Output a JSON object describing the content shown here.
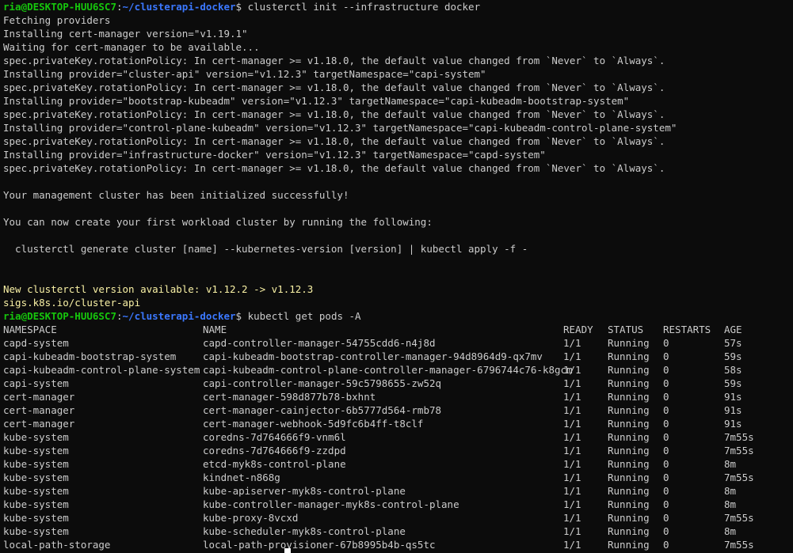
{
  "prompt": {
    "user_host": "ria@DESKTOP-HUU6SC7",
    "separator": ":",
    "path": "~/clusterapi-docker",
    "symbol": "$"
  },
  "commands": {
    "init": "clusterctl init --infrastructure docker",
    "get_pods": "kubectl get pods -A"
  },
  "init_output": [
    "Fetching providers",
    "Installing cert-manager version=\"v1.19.1\"",
    "Waiting for cert-manager to be available...",
    "spec.privateKey.rotationPolicy: In cert-manager >= v1.18.0, the default value changed from `Never` to `Always`.",
    "Installing provider=\"cluster-api\" version=\"v1.12.3\" targetNamespace=\"capi-system\"",
    "spec.privateKey.rotationPolicy: In cert-manager >= v1.18.0, the default value changed from `Never` to `Always`.",
    "Installing provider=\"bootstrap-kubeadm\" version=\"v1.12.3\" targetNamespace=\"capi-kubeadm-bootstrap-system\"",
    "spec.privateKey.rotationPolicy: In cert-manager >= v1.18.0, the default value changed from `Never` to `Always`.",
    "Installing provider=\"control-plane-kubeadm\" version=\"v1.12.3\" targetNamespace=\"capi-kubeadm-control-plane-system\"",
    "spec.privateKey.rotationPolicy: In cert-manager >= v1.18.0, the default value changed from `Never` to `Always`.",
    "Installing provider=\"infrastructure-docker\" version=\"v1.12.3\" targetNamespace=\"capd-system\"",
    "spec.privateKey.rotationPolicy: In cert-manager >= v1.18.0, the default value changed from `Never` to `Always`."
  ],
  "success_message": "Your management cluster has been initialized successfully!",
  "next_steps_message": "You can now create your first workload cluster by running the following:",
  "generate_command": "  clusterctl generate cluster [name] --kubernetes-version [version] | kubectl apply -f -",
  "update_notice": {
    "line1": "New clusterctl version available: v1.12.2 -> v1.12.3",
    "line2": "sigs.k8s.io/cluster-api"
  },
  "pods_table": {
    "headers": [
      "NAMESPACE",
      "NAME",
      "READY",
      "STATUS",
      "RESTARTS",
      "AGE"
    ],
    "rows": [
      [
        "capd-system",
        "capd-controller-manager-54755cdd6-n4j8d",
        "1/1",
        "Running",
        "0",
        "57s"
      ],
      [
        "capi-kubeadm-bootstrap-system",
        "capi-kubeadm-bootstrap-controller-manager-94d8964d9-qx7mv",
        "1/1",
        "Running",
        "0",
        "59s"
      ],
      [
        "capi-kubeadm-control-plane-system",
        "capi-kubeadm-control-plane-controller-manager-6796744c76-k8gcm",
        "1/1",
        "Running",
        "0",
        "58s"
      ],
      [
        "capi-system",
        "capi-controller-manager-59c5798655-zw52q",
        "1/1",
        "Running",
        "0",
        "59s"
      ],
      [
        "cert-manager",
        "cert-manager-598d877b78-bxhnt",
        "1/1",
        "Running",
        "0",
        "91s"
      ],
      [
        "cert-manager",
        "cert-manager-cainjector-6b5777d564-rmb78",
        "1/1",
        "Running",
        "0",
        "91s"
      ],
      [
        "cert-manager",
        "cert-manager-webhook-5d9fc6b4ff-t8clf",
        "1/1",
        "Running",
        "0",
        "91s"
      ],
      [
        "kube-system",
        "coredns-7d764666f9-vnm6l",
        "1/1",
        "Running",
        "0",
        "7m55s"
      ],
      [
        "kube-system",
        "coredns-7d764666f9-zzdpd",
        "1/1",
        "Running",
        "0",
        "7m55s"
      ],
      [
        "kube-system",
        "etcd-myk8s-control-plane",
        "1/1",
        "Running",
        "0",
        "8m"
      ],
      [
        "kube-system",
        "kindnet-n868g",
        "1/1",
        "Running",
        "0",
        "7m55s"
      ],
      [
        "kube-system",
        "kube-apiserver-myk8s-control-plane",
        "1/1",
        "Running",
        "0",
        "8m"
      ],
      [
        "kube-system",
        "kube-controller-manager-myk8s-control-plane",
        "1/1",
        "Running",
        "0",
        "8m"
      ],
      [
        "kube-system",
        "kube-proxy-8vcxd",
        "1/1",
        "Running",
        "0",
        "7m55s"
      ],
      [
        "kube-system",
        "kube-scheduler-myk8s-control-plane",
        "1/1",
        "Running",
        "0",
        "8m"
      ],
      [
        "local-path-storage",
        "local-path-provisioner-67b8995b4b-qs5tc",
        "1/1",
        "Running",
        "0",
        "7m55s"
      ]
    ]
  },
  "colors": {
    "background": "#0c0c0c",
    "foreground": "#cccccc",
    "prompt_user": "#16c60c",
    "prompt_path": "#3b78ff",
    "notice": "#f9f1a5"
  }
}
